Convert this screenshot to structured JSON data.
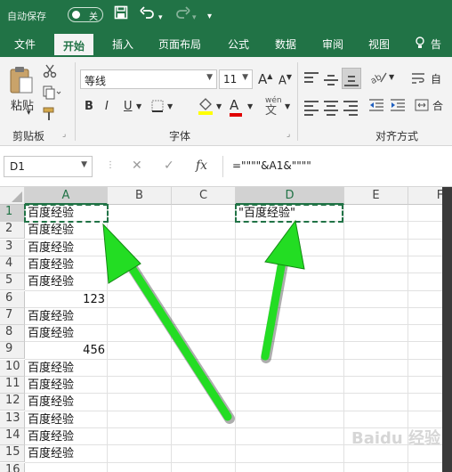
{
  "titlebar": {
    "autosave_label": "自动保存",
    "autosave_state": "关",
    "icons": [
      "save-icon",
      "undo-icon",
      "redo-icon",
      "customize-qat-icon"
    ]
  },
  "tabs": [
    "文件",
    "开始",
    "插入",
    "页面布局",
    "公式",
    "数据",
    "审阅",
    "视图",
    "告"
  ],
  "ribbon": {
    "paste_label": "粘贴",
    "clipboard_label": "剪贴板",
    "font_name": "等线",
    "font_size": "11",
    "bold": "B",
    "italic": "I",
    "underline": "U",
    "font_group_label": "字体",
    "align_group_label": "对齐方式",
    "wen_label": "wén",
    "increase_font": "A",
    "decrease_font": "A",
    "font_color_letter": "A"
  },
  "formula_bar": {
    "name_box": "D1",
    "fx": "fx",
    "formula": "=\"\"\"\"&A1&\"\"\"\""
  },
  "columns": [
    "A",
    "B",
    "C",
    "D",
    "E",
    "F"
  ],
  "rows": [
    "1",
    "2",
    "3",
    "4",
    "5",
    "6",
    "7",
    "8",
    "9",
    "10",
    "11",
    "12",
    "13",
    "14",
    "15",
    "16"
  ],
  "cells": {
    "A": [
      "百度经验",
      "百度经验",
      "百度经验",
      "百度经验",
      "百度经验",
      "123",
      "百度经验",
      "百度经验",
      "456",
      "百度经验",
      "百度经验",
      "百度经验",
      "百度经验",
      "百度经验",
      "百度经验",
      ""
    ],
    "D1": "\"百度经验\""
  },
  "watermark": "Baidu 经验",
  "colors": {
    "brand": "#217346",
    "arrow": "#22dd22"
  }
}
